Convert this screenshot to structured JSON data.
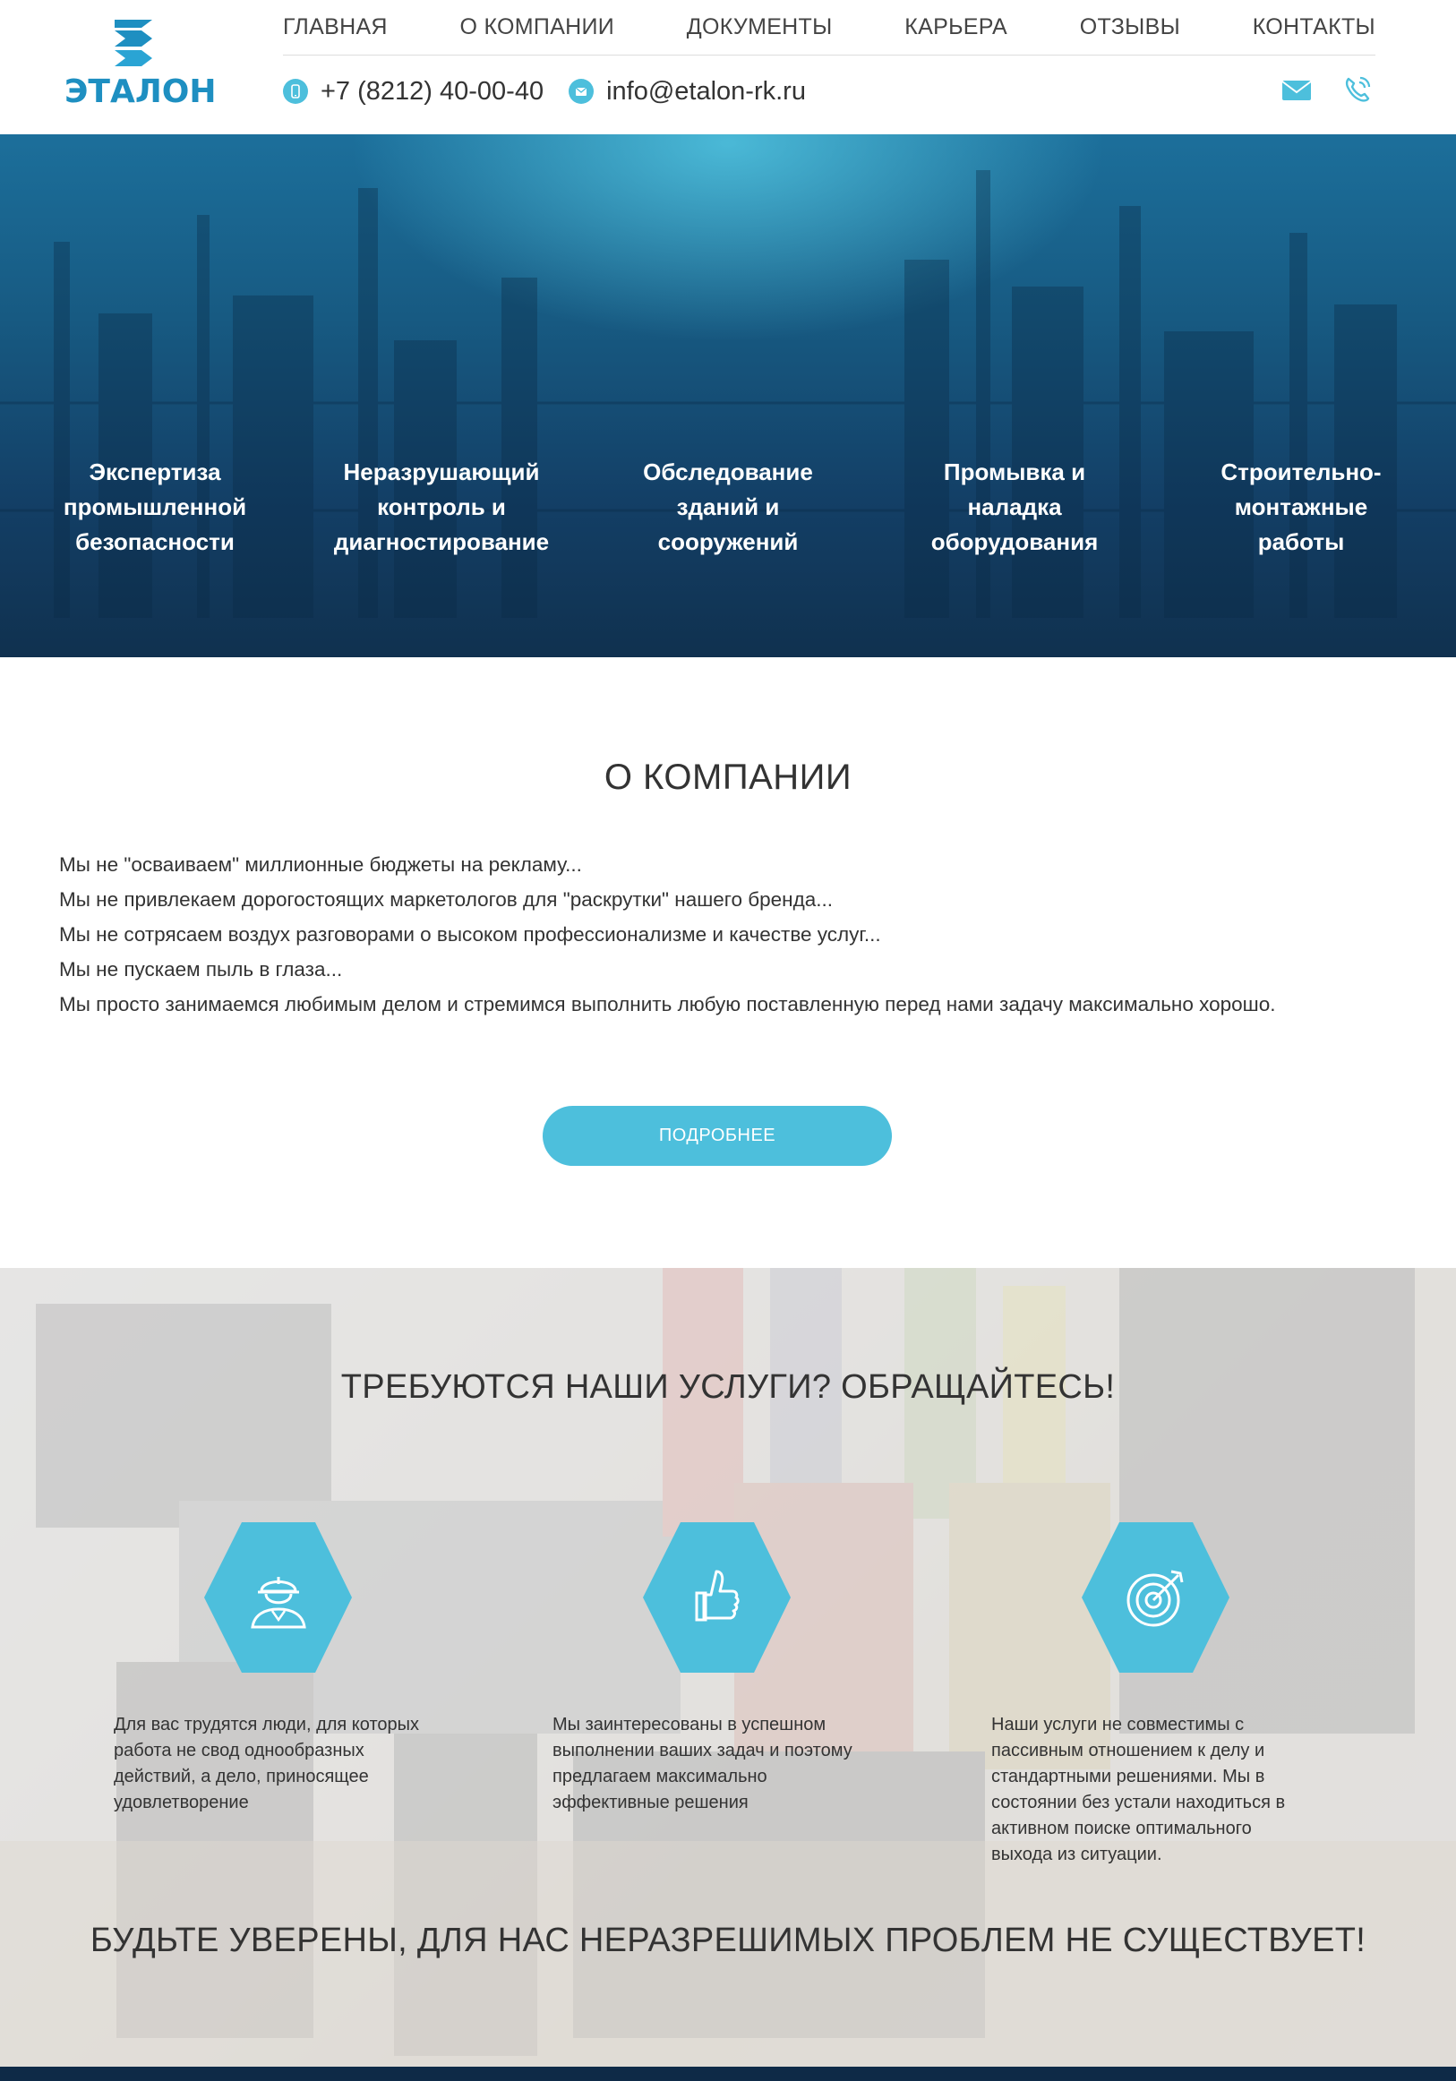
{
  "brand": {
    "logo_text": "ЭТАЛОН",
    "accent": "#4dbfdc",
    "logo_color": "#1e8fc1"
  },
  "nav": {
    "items": [
      {
        "label": "ГЛАВНАЯ"
      },
      {
        "label": "О КОМПАНИИ"
      },
      {
        "label": "ДОКУМЕНТЫ"
      },
      {
        "label": "КАРЬЕРА"
      },
      {
        "label": "ОТЗЫВЫ"
      },
      {
        "label": "КОНТАКТЫ"
      }
    ]
  },
  "contacts": {
    "phone": "+7 (8212) 40-00-40",
    "phone_icon": "phone-icon",
    "email": "info@etalon-rk.ru",
    "email_icon": "mail-icon",
    "social_icons": [
      "envelope-icon",
      "call-icon"
    ]
  },
  "hero": {
    "services": [
      {
        "label": "Экспертиза промышленной безопасности"
      },
      {
        "label": "Неразрушающий контроль и диагностирование"
      },
      {
        "label": "Обследование зданий и сооружений"
      },
      {
        "label": "Промывка и наладка оборудования"
      },
      {
        "label": "Строительно-монтажные работы"
      }
    ]
  },
  "about": {
    "title": "О КОМПАНИИ",
    "lines": [
      "Мы не \"осваиваем\" миллионные бюджеты на рекламу...",
      "Мы не привлекаем дорогостоящих маркетологов для \"раскрутки\" нашего бренда...",
      "Мы не сотрясаем воздух разговорами о высоком профессионализме и качестве услуг...",
      "Мы не пускаем пыль в глаза...",
      "Мы просто занимаемся любимым делом и стремимся выполнить любую поставленную перед нами задачу максимально хорошо."
    ],
    "button": "ПОДРОБНЕЕ"
  },
  "promo": {
    "title": "ТРЕБУЮТСЯ НАШИ УСЛУГИ? ОБРАЩАЙТЕСЬ!",
    "features": [
      {
        "icon": "worker-icon",
        "text": "Для вас трудятся люди, для которых работа не свод однообразных действий, а дело, приносящее удовлетворение"
      },
      {
        "icon": "thumbs-up-icon",
        "text": "Мы заинтересованы в успешном выполнении ваших задач и поэтому предлагаем максимально эффективные решения"
      },
      {
        "icon": "target-icon",
        "text": "Наши услуги не совместимы с пассивным отношением к делу и стандартными решениями. Мы в состоянии без устали находиться в активном поиске оптимального выхода из ситуации."
      }
    ],
    "bottom": "БУДЬТЕ УВЕРЕНЫ, ДЛЯ НАС НЕРАЗРЕШИМЫХ ПРОБЛЕМ НЕ СУЩЕСТВУЕТ!"
  }
}
